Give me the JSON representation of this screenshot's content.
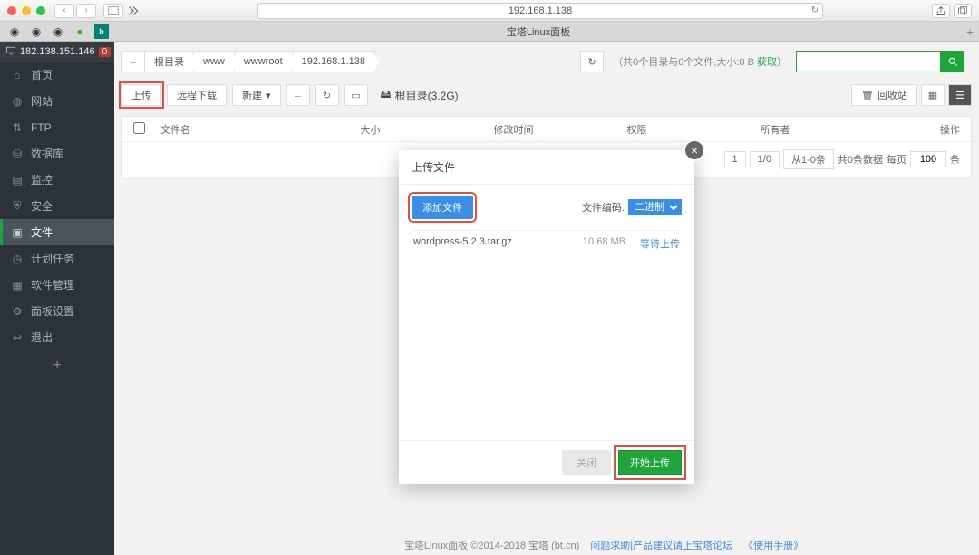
{
  "browser": {
    "url": "192.168.1.138",
    "tab_title": "宝塔Linux面板"
  },
  "sidebar": {
    "ip": "182.138.151.146",
    "badge": "0",
    "items": [
      {
        "label": "首页",
        "icon": "home"
      },
      {
        "label": "网站",
        "icon": "globe"
      },
      {
        "label": "FTP",
        "icon": "ftp"
      },
      {
        "label": "数据库",
        "icon": "database"
      },
      {
        "label": "监控",
        "icon": "monitor"
      },
      {
        "label": "安全",
        "icon": "shield"
      },
      {
        "label": "文件",
        "icon": "folder"
      },
      {
        "label": "计划任务",
        "icon": "clock"
      },
      {
        "label": "软件管理",
        "icon": "grid"
      },
      {
        "label": "面板设置",
        "icon": "gear"
      },
      {
        "label": "退出",
        "icon": "exit"
      }
    ]
  },
  "breadcrumb": [
    "根目录",
    "www",
    "wwwroot",
    "192.168.1.138"
  ],
  "info_text": "（共0个目录与0个文件,大小:0 B ",
  "info_get": "获取",
  "info_close": "）",
  "toolbar": {
    "upload": "上传",
    "remote": "远程下载",
    "new": "新建",
    "root": "根目录(3.2G)",
    "recycle": "回收站"
  },
  "table": {
    "headers": {
      "name": "文件名",
      "size": "大小",
      "mtime": "修改时间",
      "perm": "权限",
      "owner": "所有者",
      "op": "操作"
    }
  },
  "pagination": {
    "page": "1",
    "ratio": "1/0",
    "range": "从1-0条",
    "total": "共0条数据",
    "perpage": "每页",
    "perpage_val": "100",
    "unit": "条"
  },
  "modal": {
    "title": "上传文件",
    "add_file": "添加文件",
    "encoding_label": "文件编码:",
    "encoding_value": "二进制",
    "file": {
      "name": "wordpress-5.2.3.tar.gz",
      "size": "10.68 MB",
      "status": "等待上传"
    },
    "cancel": "关闭",
    "start": "开始上传"
  },
  "footer": {
    "copyright": "宝塔Linux面板 ©2014-2018 宝塔 (bt.cn)",
    "link1": "问题求助|产品建议请上宝塔论坛",
    "link2": "《使用手册》"
  }
}
